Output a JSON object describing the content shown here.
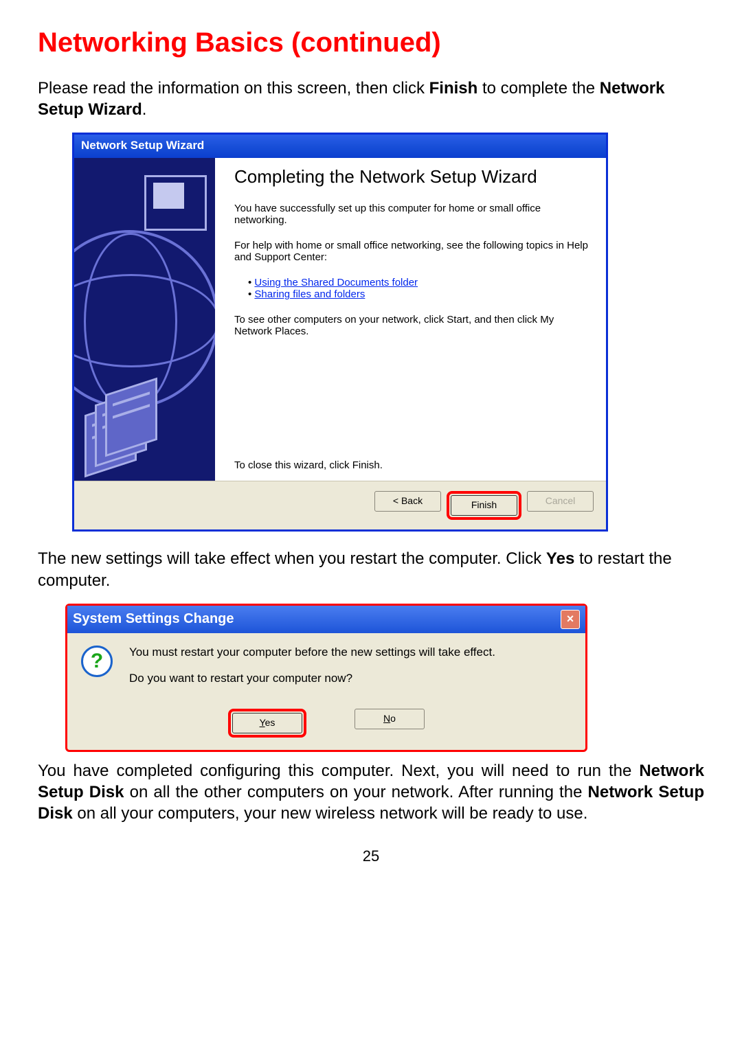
{
  "heading": "Networking Basics (continued)",
  "intro_parts": {
    "before": "Please read the information on this screen, then click ",
    "bold1": "Finish",
    "mid": " to complete the ",
    "bold2": "Network Setup Wizard",
    "after": "."
  },
  "wizard": {
    "title": "Network Setup Wizard",
    "heading": "Completing the Network Setup Wizard",
    "p1": "You have successfully set up this computer for home or small office networking.",
    "p2": "For help with home or small office networking, see the following topics in Help and Support Center:",
    "link1": "Using the Shared Documents folder",
    "link2": "Sharing files and folders",
    "p3": "To see other computers on your network, click Start, and then click My Network Places.",
    "p_close": "To close this wizard, click Finish.",
    "btn_back": "< Back",
    "btn_finish": "Finish",
    "btn_cancel": "Cancel"
  },
  "para2_parts": {
    "before": "The new settings will take effect when you restart the computer. Click ",
    "bold": "Yes",
    "after": " to restart the computer."
  },
  "msgbox": {
    "title": "System Settings Change",
    "line1": "You must restart your computer before the new settings will take effect.",
    "line2": "Do you want to restart your computer now?",
    "yes": "Yes",
    "no": "No",
    "close": "×"
  },
  "para3_parts": {
    "t1": "You have completed configuring this computer. Next, you will need to run the ",
    "b1": "Network Setup Disk",
    "t2": " on all the other computers on your network. After running the ",
    "b2": "Network Setup Disk",
    "t3": " on all your computers, your new wireless network will be ready to use."
  },
  "page_number": "25"
}
